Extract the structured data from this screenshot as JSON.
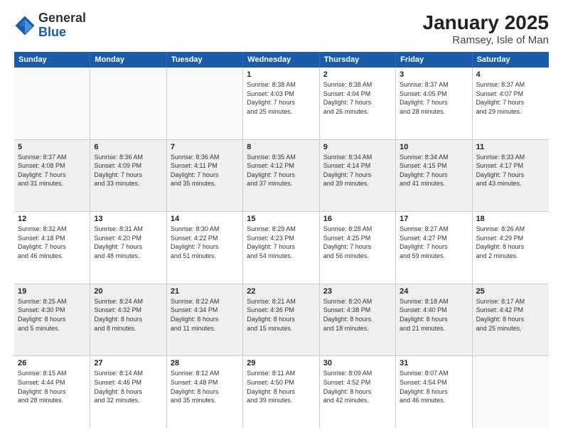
{
  "logo": {
    "general": "General",
    "blue": "Blue"
  },
  "title": "January 2025",
  "subtitle": "Ramsey, Isle of Man",
  "header_days": [
    "Sunday",
    "Monday",
    "Tuesday",
    "Wednesday",
    "Thursday",
    "Friday",
    "Saturday"
  ],
  "weeks": [
    [
      {
        "day": "",
        "info": "",
        "empty": true
      },
      {
        "day": "",
        "info": "",
        "empty": true
      },
      {
        "day": "",
        "info": "",
        "empty": true
      },
      {
        "day": "1",
        "info": "Sunrise: 8:38 AM\nSunset: 4:03 PM\nDaylight: 7 hours\nand 25 minutes.",
        "empty": false
      },
      {
        "day": "2",
        "info": "Sunrise: 8:38 AM\nSunset: 4:04 PM\nDaylight: 7 hours\nand 26 minutes.",
        "empty": false
      },
      {
        "day": "3",
        "info": "Sunrise: 8:37 AM\nSunset: 4:05 PM\nDaylight: 7 hours\nand 28 minutes.",
        "empty": false
      },
      {
        "day": "4",
        "info": "Sunrise: 8:37 AM\nSunset: 4:07 PM\nDaylight: 7 hours\nand 29 minutes.",
        "empty": false
      }
    ],
    [
      {
        "day": "5",
        "info": "Sunrise: 8:37 AM\nSunset: 4:08 PM\nDaylight: 7 hours\nand 31 minutes.",
        "empty": false
      },
      {
        "day": "6",
        "info": "Sunrise: 8:36 AM\nSunset: 4:09 PM\nDaylight: 7 hours\nand 33 minutes.",
        "empty": false
      },
      {
        "day": "7",
        "info": "Sunrise: 8:36 AM\nSunset: 4:11 PM\nDaylight: 7 hours\nand 35 minutes.",
        "empty": false
      },
      {
        "day": "8",
        "info": "Sunrise: 8:35 AM\nSunset: 4:12 PM\nDaylight: 7 hours\nand 37 minutes.",
        "empty": false
      },
      {
        "day": "9",
        "info": "Sunrise: 8:34 AM\nSunset: 4:14 PM\nDaylight: 7 hours\nand 39 minutes.",
        "empty": false
      },
      {
        "day": "10",
        "info": "Sunrise: 8:34 AM\nSunset: 4:15 PM\nDaylight: 7 hours\nand 41 minutes.",
        "empty": false
      },
      {
        "day": "11",
        "info": "Sunrise: 8:33 AM\nSunset: 4:17 PM\nDaylight: 7 hours\nand 43 minutes.",
        "empty": false
      }
    ],
    [
      {
        "day": "12",
        "info": "Sunrise: 8:32 AM\nSunset: 4:18 PM\nDaylight: 7 hours\nand 46 minutes.",
        "empty": false
      },
      {
        "day": "13",
        "info": "Sunrise: 8:31 AM\nSunset: 4:20 PM\nDaylight: 7 hours\nand 48 minutes.",
        "empty": false
      },
      {
        "day": "14",
        "info": "Sunrise: 8:30 AM\nSunset: 4:22 PM\nDaylight: 7 hours\nand 51 minutes.",
        "empty": false
      },
      {
        "day": "15",
        "info": "Sunrise: 8:29 AM\nSunset: 4:23 PM\nDaylight: 7 hours\nand 54 minutes.",
        "empty": false
      },
      {
        "day": "16",
        "info": "Sunrise: 8:28 AM\nSunset: 4:25 PM\nDaylight: 7 hours\nand 56 minutes.",
        "empty": false
      },
      {
        "day": "17",
        "info": "Sunrise: 8:27 AM\nSunset: 4:27 PM\nDaylight: 7 hours\nand 59 minutes.",
        "empty": false
      },
      {
        "day": "18",
        "info": "Sunrise: 8:26 AM\nSunset: 4:29 PM\nDaylight: 8 hours\nand 2 minutes.",
        "empty": false
      }
    ],
    [
      {
        "day": "19",
        "info": "Sunrise: 8:25 AM\nSunset: 4:30 PM\nDaylight: 8 hours\nand 5 minutes.",
        "empty": false
      },
      {
        "day": "20",
        "info": "Sunrise: 8:24 AM\nSunset: 4:32 PM\nDaylight: 8 hours\nand 8 minutes.",
        "empty": false
      },
      {
        "day": "21",
        "info": "Sunrise: 8:22 AM\nSunset: 4:34 PM\nDaylight: 8 hours\nand 11 minutes.",
        "empty": false
      },
      {
        "day": "22",
        "info": "Sunrise: 8:21 AM\nSunset: 4:36 PM\nDaylight: 8 hours\nand 15 minutes.",
        "empty": false
      },
      {
        "day": "23",
        "info": "Sunrise: 8:20 AM\nSunset: 4:38 PM\nDaylight: 8 hours\nand 18 minutes.",
        "empty": false
      },
      {
        "day": "24",
        "info": "Sunrise: 8:18 AM\nSunset: 4:40 PM\nDaylight: 8 hours\nand 21 minutes.",
        "empty": false
      },
      {
        "day": "25",
        "info": "Sunrise: 8:17 AM\nSunset: 4:42 PM\nDaylight: 8 hours\nand 25 minutes.",
        "empty": false
      }
    ],
    [
      {
        "day": "26",
        "info": "Sunrise: 8:15 AM\nSunset: 4:44 PM\nDaylight: 8 hours\nand 28 minutes.",
        "empty": false
      },
      {
        "day": "27",
        "info": "Sunrise: 8:14 AM\nSunset: 4:46 PM\nDaylight: 8 hours\nand 32 minutes.",
        "empty": false
      },
      {
        "day": "28",
        "info": "Sunrise: 8:12 AM\nSunset: 4:48 PM\nDaylight: 8 hours\nand 35 minutes.",
        "empty": false
      },
      {
        "day": "29",
        "info": "Sunrise: 8:11 AM\nSunset: 4:50 PM\nDaylight: 8 hours\nand 39 minutes.",
        "empty": false
      },
      {
        "day": "30",
        "info": "Sunrise: 8:09 AM\nSunset: 4:52 PM\nDaylight: 8 hours\nand 42 minutes.",
        "empty": false
      },
      {
        "day": "31",
        "info": "Sunrise: 8:07 AM\nSunset: 4:54 PM\nDaylight: 8 hours\nand 46 minutes.",
        "empty": false
      },
      {
        "day": "",
        "info": "",
        "empty": true
      }
    ]
  ]
}
